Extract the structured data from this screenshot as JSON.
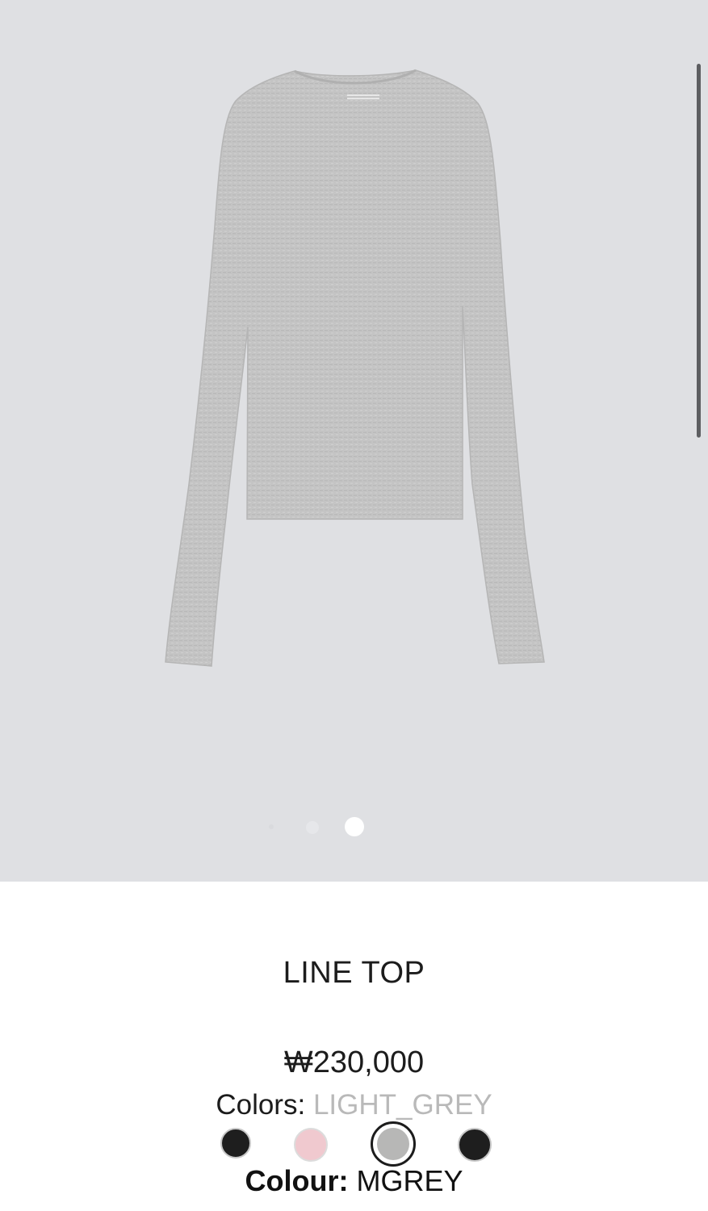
{
  "gallery": {
    "image_description_icon": "long-sleeve-tshirt-icon",
    "slide_count": 3,
    "active_slide": 3
  },
  "product": {
    "title": "LINE TOP",
    "price": "₩230,000"
  },
  "colors": {
    "label": "Colors:",
    "value": "LIGHT_GREY",
    "swatches": [
      {
        "color": "#1e1e1e"
      },
      {
        "color": "#f0c9cf"
      },
      {
        "color": "#b7b7b6",
        "selected": true
      },
      {
        "color": "#1e1e1e"
      }
    ]
  },
  "colour": {
    "label": "Colour:",
    "value": "MGREY"
  },
  "theme": {
    "gallery_bg": "#dfe0e3",
    "text": "#1c1c1c",
    "muted": "#b9b9b9"
  }
}
